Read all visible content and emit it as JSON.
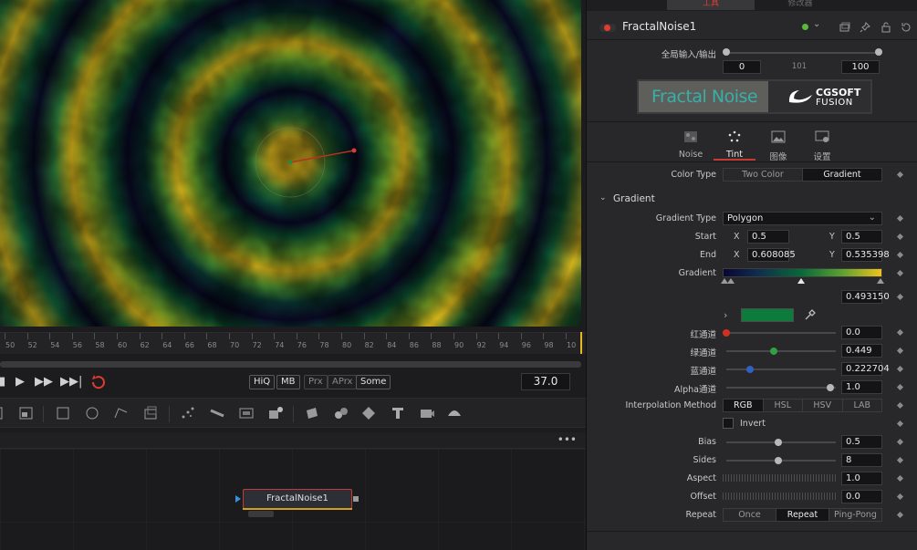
{
  "timeline": {
    "ruler_labels": [
      "50",
      "52",
      "54",
      "56",
      "58",
      "60",
      "62",
      "64",
      "66",
      "68",
      "70",
      "72",
      "74",
      "76",
      "78",
      "80",
      "82",
      "84",
      "86",
      "88",
      "90",
      "92",
      "94",
      "96",
      "98",
      "10"
    ],
    "current_frame": "37.0",
    "toggles": [
      "HiQ",
      "MB",
      "Prx",
      "APrx",
      "Some"
    ]
  },
  "node": {
    "name": "FractalNoise1"
  },
  "panel": {
    "top_tabs": [
      "工具",
      "修改器"
    ],
    "tool_name": "FractalNoise1",
    "global_io_label": "全局输入/输出",
    "global_in": "0",
    "global_mid": "101",
    "global_out": "100",
    "logo_title": "Fractal Noise",
    "logo_brand_1": "CGSOFT",
    "logo_brand_2": "FUSION",
    "tabs": [
      {
        "label": "Noise",
        "icon": "noise-icon"
      },
      {
        "label": "Tint",
        "icon": "tint-icon"
      },
      {
        "label": "图像",
        "icon": "image-icon"
      },
      {
        "label": "设置",
        "icon": "settings-icon"
      }
    ],
    "color_type": {
      "label": "Color Type",
      "options": [
        "Two Color",
        "Gradient"
      ],
      "selected": "Gradient"
    },
    "gradient_section": "Gradient",
    "gradient_type": {
      "label": "Gradient Type",
      "value": "Polygon"
    },
    "start": {
      "label": "Start",
      "x": "0.5",
      "y": "0.5"
    },
    "end": {
      "label": "End",
      "x": "0.608085",
      "y": "0.535398"
    },
    "gradient_label": "Gradient",
    "gradient_pos": "0.493150",
    "red": {
      "label": "红通道",
      "value": "0.0"
    },
    "green": {
      "label": "绿通道",
      "value": "0.449"
    },
    "blue": {
      "label": "蓝通道",
      "value": "0.222704"
    },
    "alpha": {
      "label": "Alpha通道",
      "value": "1.0"
    },
    "interp": {
      "label": "Interpolation Method",
      "options": [
        "RGB",
        "HSL",
        "HSV",
        "LAB"
      ],
      "selected": "RGB"
    },
    "invert": "Invert",
    "bias": {
      "label": "Bias",
      "value": "0.5"
    },
    "sides": {
      "label": "Sides",
      "value": "8"
    },
    "aspect": {
      "label": "Aspect",
      "value": "1.0"
    },
    "offset": {
      "label": "Offset",
      "value": "0.0"
    },
    "repeat": {
      "label": "Repeat",
      "options": [
        "Once",
        "Repeat",
        "Ping-Pong"
      ],
      "selected": "Repeat"
    },
    "x_label": "X",
    "y_label": "Y"
  },
  "colors": {
    "accent_red": "#c53a32",
    "gradient_stops": [
      "#0a0632",
      "#0a6a38",
      "#f0c21a"
    ],
    "swatch": "#0d7b3c"
  }
}
